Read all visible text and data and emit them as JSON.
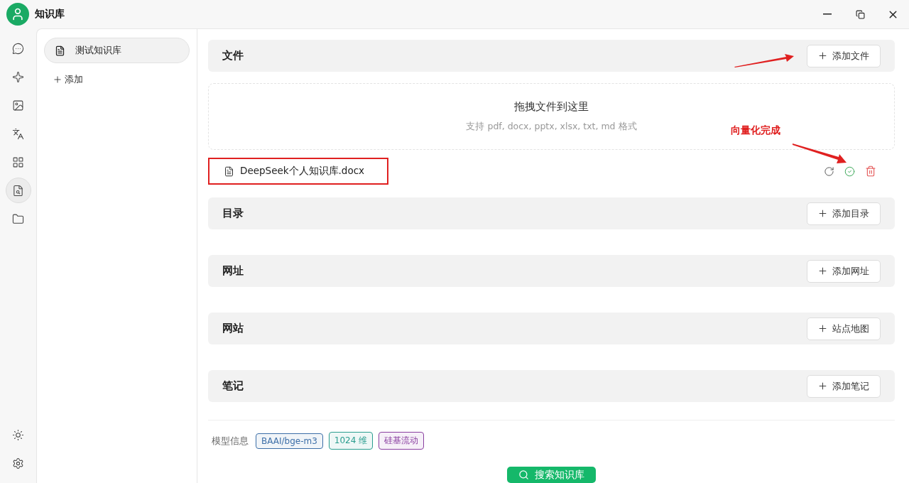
{
  "app": {
    "title": "知识库"
  },
  "rail": {
    "items": [
      {
        "kind": "chat",
        "selected": false
      },
      {
        "kind": "sparkle",
        "selected": false
      },
      {
        "kind": "image",
        "selected": false
      },
      {
        "kind": "translate",
        "selected": false
      },
      {
        "kind": "apps",
        "selected": false
      },
      {
        "kind": "knowledge",
        "selected": true
      },
      {
        "kind": "folder",
        "selected": false
      }
    ],
    "bottom": [
      {
        "kind": "theme"
      },
      {
        "kind": "settings"
      }
    ]
  },
  "sidebar": {
    "items": [
      {
        "label": "测试知识库",
        "selected": true
      }
    ],
    "add_label": "添加"
  },
  "sections": [
    {
      "title": "文件",
      "button": "添加文件",
      "dropzone": {
        "title": "拖拽文件到这里",
        "hint": "支持 pdf, docx, pptx, xlsx, txt, md 格式"
      },
      "files": [
        {
          "name": "DeepSeek个人知识库.docx",
          "done": true,
          "highlighted": true
        }
      ]
    },
    {
      "title": "目录",
      "button": "添加目录"
    },
    {
      "title": "网址",
      "button": "添加网址"
    },
    {
      "title": "网站",
      "button": "站点地图"
    },
    {
      "title": "笔记",
      "button": "添加笔记"
    }
  ],
  "model_info": {
    "label": "模型信息",
    "tags": [
      {
        "text": "BAAI/bge-m3",
        "color": "#3d6fa8"
      },
      {
        "text": "1024 维",
        "color": "#2a9d8f"
      },
      {
        "text": "硅基流动",
        "color": "#8a3fa0"
      }
    ]
  },
  "search_button": "搜索知识库",
  "annotations": [
    {
      "text": "向量化完成"
    }
  ]
}
